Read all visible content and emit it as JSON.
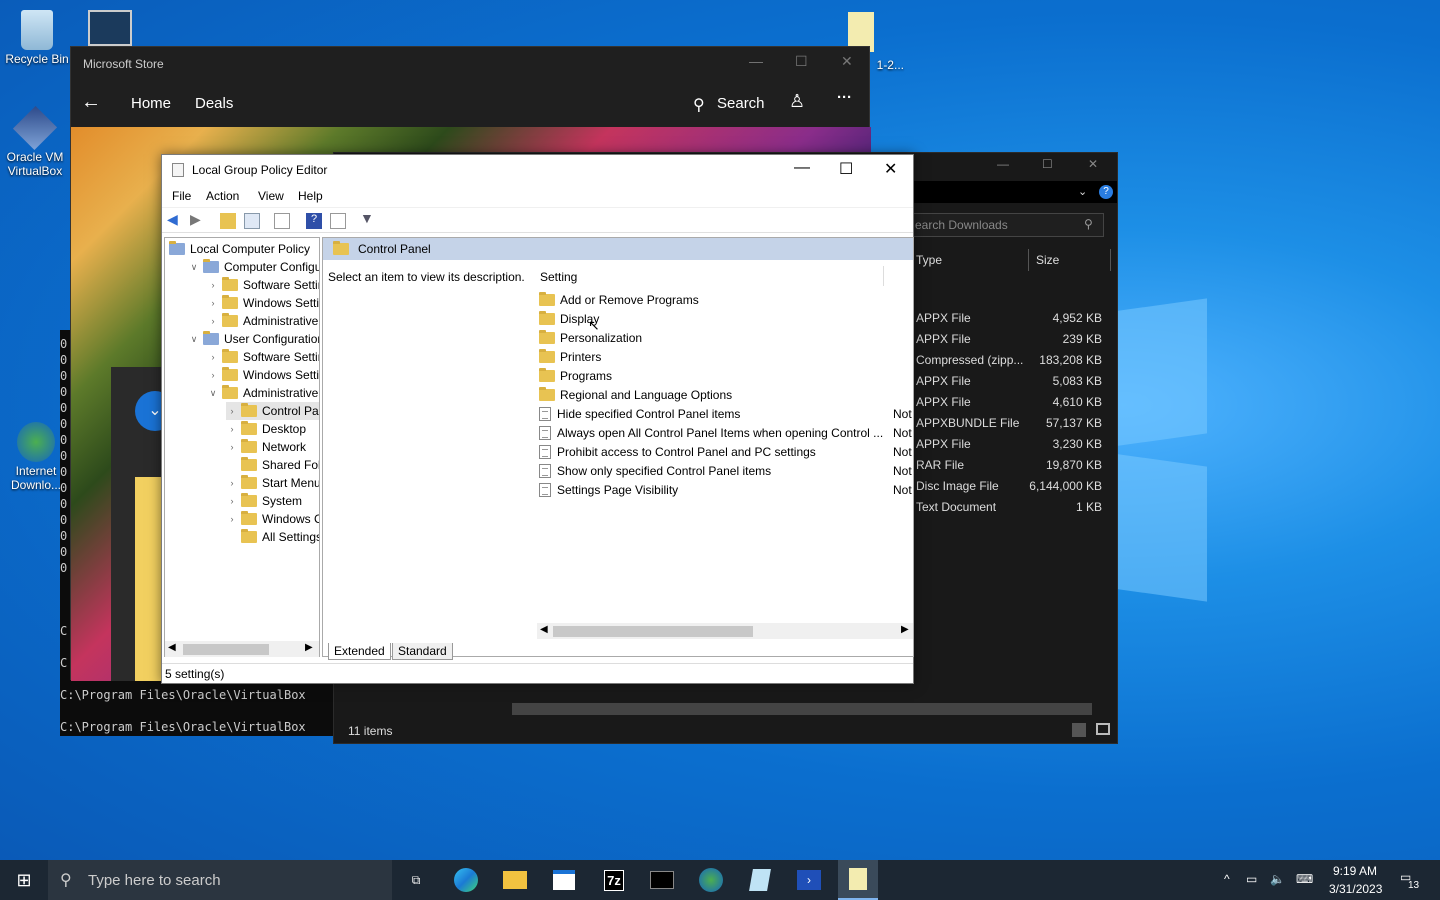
{
  "desktop": {
    "icons": [
      {
        "label": "Recycle Bin"
      },
      {
        "label": "Oracle VM VirtualBox"
      },
      {
        "label": "Internet Downlo..."
      },
      {
        "label": "1-2..."
      }
    ]
  },
  "store": {
    "title": "Microsoft Store",
    "nav": {
      "home": "Home",
      "deals": "Deals",
      "search": "Search"
    }
  },
  "console": {
    "lines": [
      "C:\\Program Files\\Oracle\\VirtualBox",
      "C:\\Program Files\\Oracle\\VirtualBox"
    ],
    "zeros": "0",
    "c": "C"
  },
  "explorer": {
    "search_placeholder": "earch Downloads",
    "columns": {
      "type": "Type",
      "size": "Size"
    },
    "rows": [
      {
        "type": "APPX File",
        "size": "4,952 KB"
      },
      {
        "type": "APPX File",
        "size": "239 KB"
      },
      {
        "type": "Compressed (zipp...",
        "size": "183,208 KB"
      },
      {
        "type": "APPX File",
        "size": "5,083 KB"
      },
      {
        "type": "APPX File",
        "size": "4,610 KB"
      },
      {
        "type": "APPXBUNDLE File",
        "size": "57,137 KB"
      },
      {
        "type": "APPX File",
        "size": "3,230 KB"
      },
      {
        "type": "RAR File",
        "size": "19,870 KB"
      },
      {
        "type": "Disc Image File",
        "size": "6,144,000 KB"
      },
      {
        "type": "Text Document",
        "size": "1 KB"
      }
    ],
    "status": "11 items"
  },
  "gpedit": {
    "title": "Local Group Policy Editor",
    "menu": [
      "File",
      "Action",
      "View",
      "Help"
    ],
    "tree": [
      "Local Computer Policy",
      "Computer Configura",
      "Software Settings",
      "Windows Setting",
      "Administrative Te",
      "User Configuration",
      "Software Settings",
      "Windows Setting",
      "Administrative Te",
      "Control Panel",
      "Desktop",
      "Network",
      "Shared Folder",
      "Start Menu ar",
      "System",
      "Windows Cor",
      "All Settings"
    ],
    "pane_title": "Control Panel",
    "description": "Select an item to view its description.",
    "setting_header": "Setting",
    "items": [
      "Add or Remove Programs",
      "Display",
      "Personalization",
      "Printers",
      "Programs",
      "Regional and Language Options",
      "Hide specified Control Panel items",
      "Always open All Control Panel Items when opening Control ...",
      "Prohibit access to Control Panel and PC settings",
      "Show only specified Control Panel items",
      "Settings Page Visibility"
    ],
    "state": "Not",
    "tabs": [
      "Extended",
      "Standard"
    ],
    "status": "5 setting(s)"
  },
  "taskbar": {
    "search_placeholder": "Type here to search",
    "time": "9:19 AM",
    "date": "3/31/2023",
    "notif_count": "13"
  }
}
